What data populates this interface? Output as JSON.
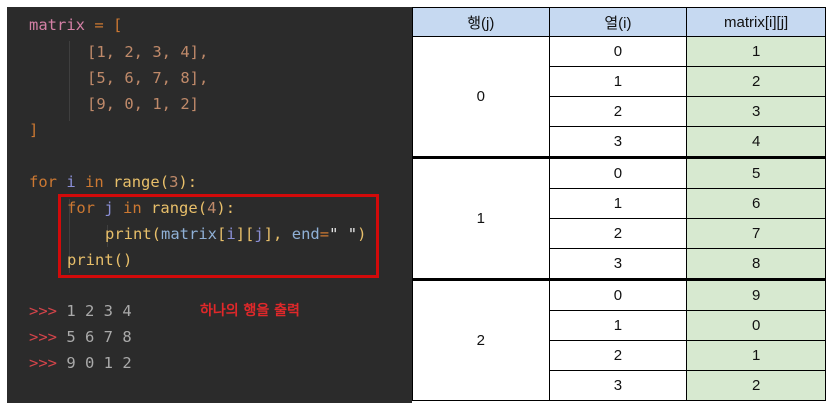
{
  "code": {
    "matrix_name": "matrix",
    "rows": [
      "[1, 2, 3, 4],",
      "[5, 6, 7, 8],",
      "[9, 0, 1, 2]"
    ],
    "outer_loop": {
      "kw_for": "for",
      "var": "i",
      "kw_in": "in",
      "func": "range",
      "arg": "3"
    },
    "inner_loop": {
      "kw_for": "for",
      "var": "j",
      "kw_in": "in",
      "func": "range",
      "arg": "4"
    },
    "print_call": {
      "func": "print",
      "arr": "matrix",
      "i": "i",
      "j": "j",
      "param": "end",
      "value": "\" \""
    },
    "print_empty": "print",
    "output": [
      {
        "prompt": ">>>",
        "text": "1 2 3 4"
      },
      {
        "prompt": ">>>",
        "text": "5 6 7 8"
      },
      {
        "prompt": ">>>",
        "text": "9 0 1 2"
      }
    ],
    "annotation": "하나의 행을 출력"
  },
  "table": {
    "headers": [
      "행(j)",
      "열(i)",
      "matrix[i][j]"
    ],
    "groups": [
      {
        "row": "0",
        "cols": [
          "0",
          "1",
          "2",
          "3"
        ],
        "values": [
          "1",
          "2",
          "3",
          "4"
        ]
      },
      {
        "row": "1",
        "cols": [
          "0",
          "1",
          "2",
          "3"
        ],
        "values": [
          "5",
          "6",
          "7",
          "8"
        ]
      },
      {
        "row": "2",
        "cols": [
          "0",
          "1",
          "2",
          "3"
        ],
        "values": [
          "9",
          "0",
          "1",
          "2"
        ]
      }
    ]
  },
  "colors": {
    "highlight": "#d20a0a",
    "header_bg": "#c6d9f1",
    "value_bg": "#d7e9d0"
  }
}
